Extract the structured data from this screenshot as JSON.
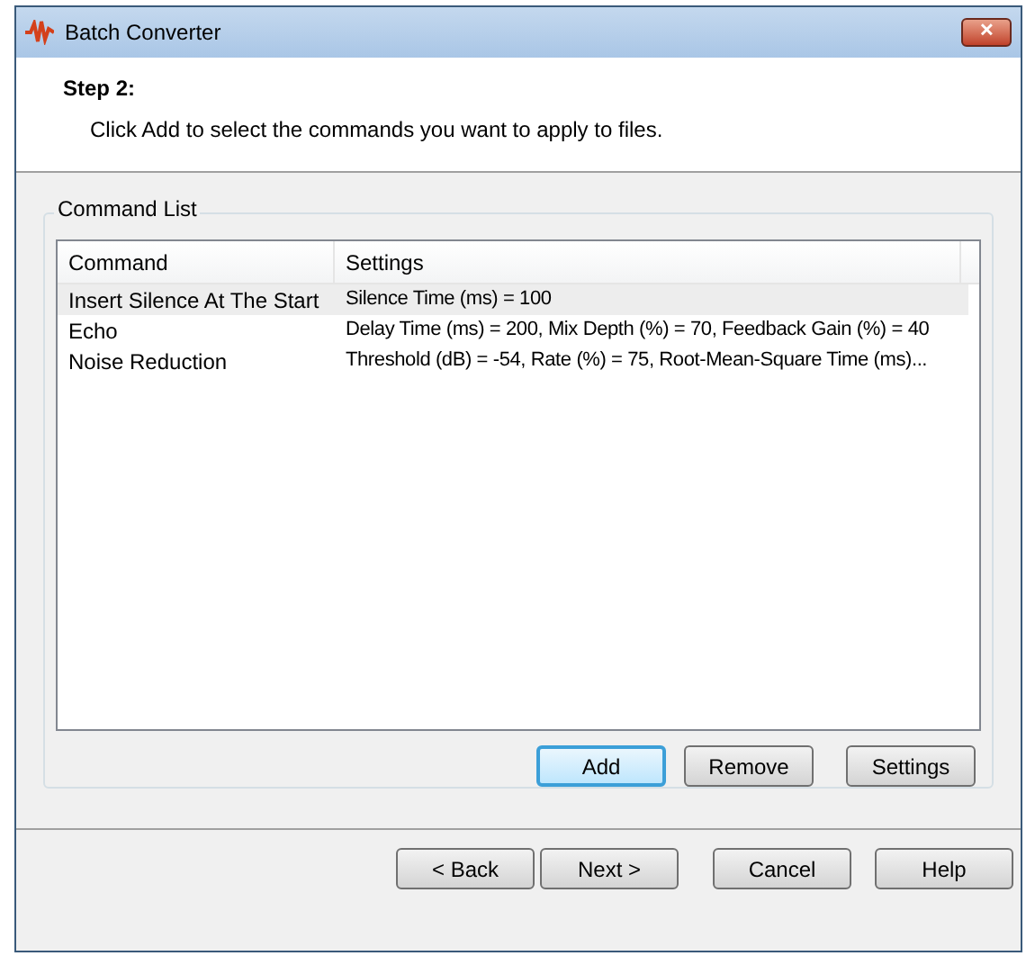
{
  "window": {
    "title": "Batch Converter",
    "close": "✕"
  },
  "header": {
    "step": "Step 2:",
    "instruction": "Click Add to select the commands you want to apply to files."
  },
  "group": {
    "title": "Command List"
  },
  "table": {
    "columns": [
      "Command",
      "Settings"
    ],
    "rows": [
      {
        "command": "Insert Silence At The Start",
        "settings": "Silence Time (ms) = 100",
        "selected": true
      },
      {
        "command": "Echo",
        "settings": "Delay Time (ms) = 200, Mix Depth (%) = 70, Feedback Gain (%) = 40",
        "selected": false
      },
      {
        "command": "Noise Reduction",
        "settings": "Threshold (dB) = -54, Rate (%) = 75, Root-Mean-Square Time (ms)...",
        "selected": false
      }
    ]
  },
  "list_buttons": [
    {
      "label": "Add",
      "default": true
    },
    {
      "label": "Remove",
      "default": false
    },
    {
      "label": "Settings",
      "default": false
    }
  ],
  "nav_buttons": [
    "< Back",
    "Next >",
    "Cancel",
    "Help"
  ]
}
